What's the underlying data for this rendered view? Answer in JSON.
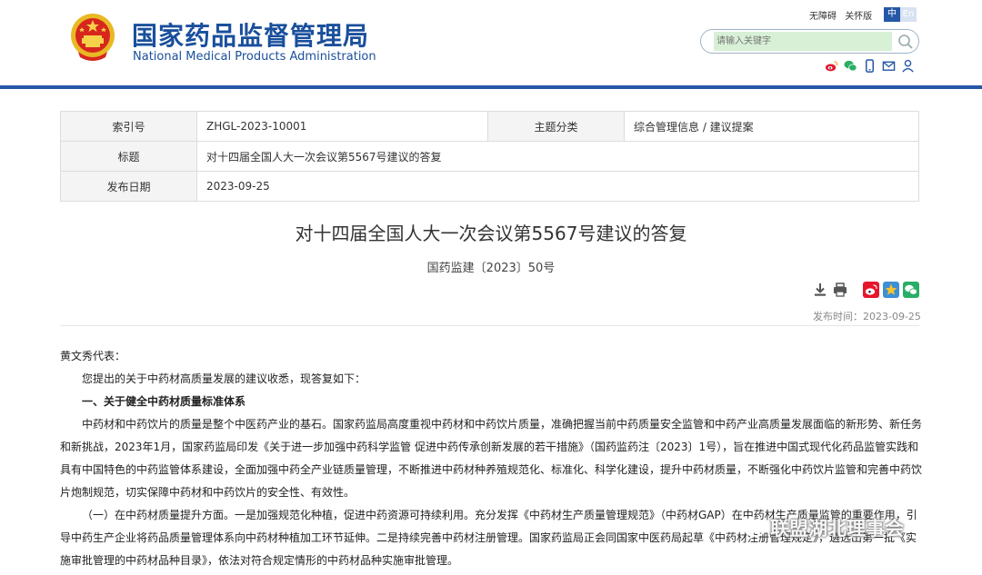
{
  "header": {
    "site_name_cn": "国家药品监督管理局",
    "site_name_en": "National Medical Products Administration",
    "util_links": [
      "无障碍",
      "关怀版"
    ],
    "lang_zh": "中",
    "lang_en": "En",
    "search_placeholder": "请输入关键字",
    "brand_color": "#1a4f9c"
  },
  "info": {
    "index_label": "索引号",
    "index_value": "ZHGL-2023-10001",
    "category_label": "主题分类",
    "category_value": "综合管理信息 / 建议提案",
    "title_label": "标题",
    "title_value": "对十四届全国人大一次会议第5567号建议的答复",
    "date_label": "发布日期",
    "date_value": "2023-09-25"
  },
  "article": {
    "title": "对十四届全国人大一次会议第5567号建议的答复",
    "doc_number": "国药监建〔2023〕50号",
    "publish_time": "发布时间：2023-09-25",
    "salutation": "黄文秀代表：",
    "intro": "您提出的关于中药材高质量发展的建议收悉，现答复如下：",
    "section1_heading": "一、关于健全中药材质量标准体系",
    "para1": "中药材和中药饮片的质量是整个中医药产业的基石。国家药监局高度重视中药材和中药饮片质量，准确把握当前中药质量安全监管和中药产业高质量发展面临的新形势、新任务和新挑战，2023年1月，国家药监局印发《关于进一步加强中药科学监管 促进中药传承创新发展的若干措施》（国药监药注〔2023〕1号），旨在推进中国式现代化药品监管实践和具有中国特色的中药监管体系建设，全面加强中药全产业链质量管理，不断推进中药材种养殖规范化、标准化、科学化建设，提升中药材质量，不断强化中药饮片监管和完善中药饮片炮制规范，切实保障中药材和中药饮片的安全性、有效性。",
    "para2": "（一）在中药材质量提升方面。一是加强规范化种植，促进中药资源可持续利用。充分发挥《中药材生产质量管理规范》（中药材GAP）在中药材生产质量监管的重要作用，引导中药生产企业将药品质量管理体系向中药材种植加工环节延伸。二是持续完善中药材注册管理。国家药监局正会同国家中医药局起草《中药材注册管理规定》，遴选出第一批《实施审批管理的中药材品种目录》，依法对符合规定情形的中药材品种实施审批管理。"
  },
  "watermark": {
    "text": "联盟湖北理事会"
  }
}
